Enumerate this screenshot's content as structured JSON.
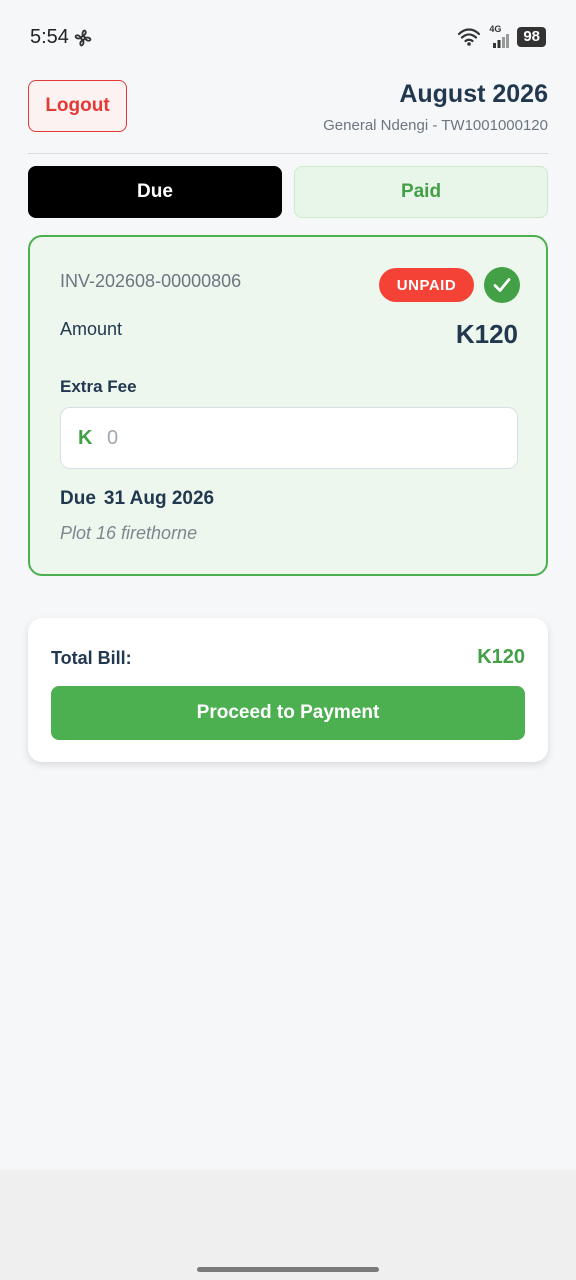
{
  "status_bar": {
    "time": "5:54",
    "network": "4G",
    "battery": "98"
  },
  "header": {
    "logout_label": "Logout",
    "month_title": "August 2026",
    "account_subtitle": "General Ndengi - TW1001000120"
  },
  "tabs": [
    {
      "label": "Due",
      "active": true
    },
    {
      "label": "Paid",
      "active": false
    }
  ],
  "invoice": {
    "id": "INV-202608-00000806",
    "status": "UNPAID",
    "amount_label": "Amount",
    "amount": "K120",
    "extra_fee_label": "Extra Fee",
    "extra_fee_currency": "K",
    "extra_fee_placeholder": "0",
    "due_label": "Due",
    "due_date": "31 Aug 2026",
    "plot": "Plot 16 firethorne"
  },
  "summary": {
    "total_label": "Total Bill:",
    "total_value": "K120",
    "pay_button": "Proceed to Payment"
  },
  "colors": {
    "accent_green": "#4caf50",
    "danger_red": "#f44336",
    "text_dark": "#22384f",
    "card_bg": "#edf7ee"
  }
}
